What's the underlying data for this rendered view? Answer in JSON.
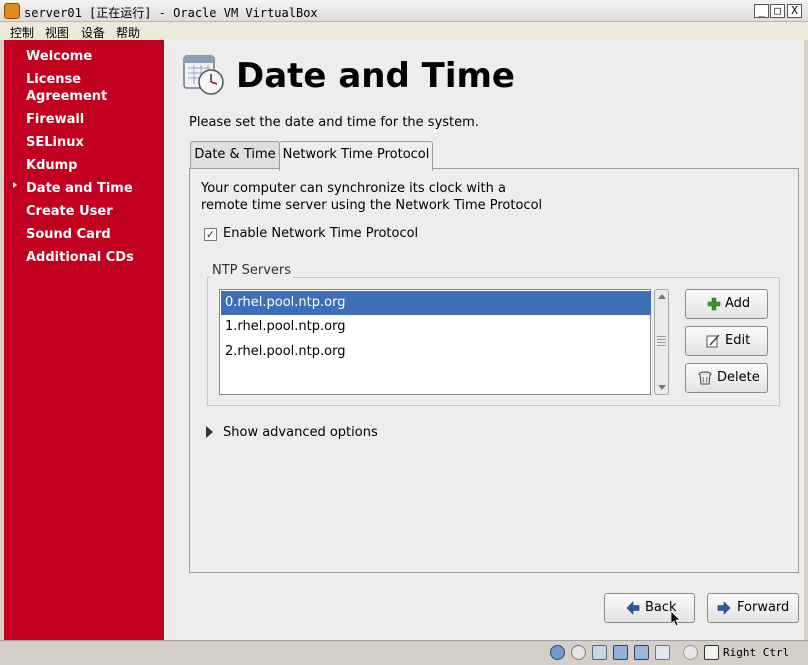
{
  "window": {
    "title": "server01 [正在运行] - Oracle VM VirtualBox",
    "minimize_glyph": "_",
    "maximize_glyph": "□",
    "close_glyph": "X"
  },
  "menubar": {
    "items": [
      "控制",
      "视图",
      "设备",
      "帮助"
    ]
  },
  "sidebar": {
    "items": [
      {
        "label": "Welcome"
      },
      {
        "label": "License Agreement"
      },
      {
        "label": "Firewall"
      },
      {
        "label": "SELinux"
      },
      {
        "label": "Kdump"
      },
      {
        "label": "Date and Time",
        "current": true
      },
      {
        "label": "Create User"
      },
      {
        "label": "Sound Card"
      },
      {
        "label": "Additional CDs"
      }
    ]
  },
  "page": {
    "title": "Date and Time",
    "description": "Please set the date and time for the system.",
    "icon": "clock-calendar-icon"
  },
  "tabs": [
    {
      "label": "Date & Time",
      "active": false
    },
    {
      "label": "Network Time Protocol",
      "active": true
    }
  ],
  "ntp": {
    "intro_line1": "Your computer can synchronize its clock with a",
    "intro_line2": "remote time server using the Network Time Protocol",
    "enable_label": "Enable Network Time Protocol",
    "enable_checked": true,
    "checkbox_mark": "✓",
    "servers_label": "NTP Servers",
    "servers": [
      {
        "name": "0.rhel.pool.ntp.org",
        "selected": true
      },
      {
        "name": "1.rhel.pool.ntp.org",
        "selected": false
      },
      {
        "name": "2.rhel.pool.ntp.org",
        "selected": false
      }
    ],
    "buttons": {
      "add": "Add",
      "edit": "Edit",
      "delete": "Delete"
    },
    "advanced_label": "Show advanced options"
  },
  "nav": {
    "back": "Back",
    "forward": "Forward"
  },
  "statusbar": {
    "host_key": "Right Ctrl"
  },
  "colors": {
    "sidebar": "#c20020",
    "selection": "#3d6fb8"
  }
}
